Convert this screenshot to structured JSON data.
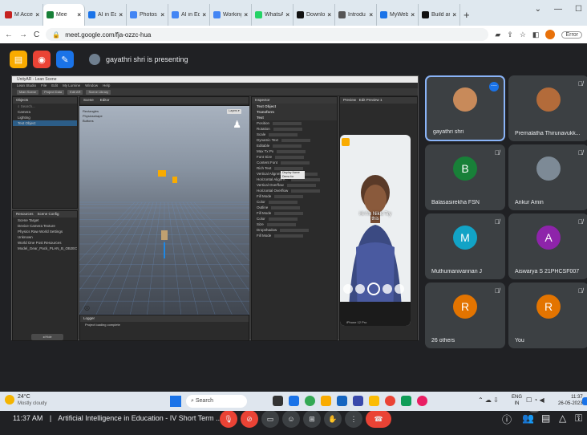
{
  "browser": {
    "tabs": [
      {
        "label": "M Accepte",
        "color": "#c5221f"
      },
      {
        "label": "Mee",
        "color": "#188038",
        "active": true
      },
      {
        "label": "AI in Edu",
        "color": "#1a73e8"
      },
      {
        "label": "Photos",
        "color": "#4285f4"
      },
      {
        "label": "AI in Edu",
        "color": "#4285f4"
      },
      {
        "label": "Working",
        "color": "#4285f4"
      },
      {
        "label": "WhatsA",
        "color": "#25d366"
      },
      {
        "label": "Downlo",
        "color": "#111111"
      },
      {
        "label": "Introdu",
        "color": "#555555"
      },
      {
        "label": "MyWeb",
        "color": "#1a73e8"
      },
      {
        "label": "Build an",
        "color": "#111111"
      }
    ],
    "new_tab": "+",
    "url": "meet.google.com/fja-ozzc-hua",
    "ext_label": "Error"
  },
  "meet": {
    "presenting_text": "gayathri shri is presenting",
    "participants": [
      {
        "name": "gayathri shri",
        "initial": "",
        "color": "#c88a5a",
        "active": true
      },
      {
        "name": "Premalatha Thirunavukk...",
        "initial": "",
        "color": "#b36b3a"
      },
      {
        "name": "Balasasirekha FSN",
        "initial": "B",
        "color": "#188038"
      },
      {
        "name": "Ankur Amin",
        "initial": "",
        "color": "#7d8a96"
      },
      {
        "name": "Muthumanivannan J",
        "initial": "M",
        "color": "#12a3c6"
      },
      {
        "name": "Aiswarya S 21PHCSF007",
        "initial": "A",
        "color": "#8e24aa"
      },
      {
        "name": "26 others",
        "initial": "R",
        "color": "#e37400"
      },
      {
        "name": "You",
        "initial": "R",
        "color": "#e37400"
      }
    ],
    "footer": {
      "time": "11:37 AM",
      "separator": "|",
      "title": "Artificial Intelligence in Education - IV Short Term ...",
      "people_count": "33"
    }
  },
  "unity": {
    "window_title": "UnityAR - Lean Scene",
    "menu": [
      "Lean Studio",
      "File",
      "Edit",
      "My Lumine",
      "Window",
      "Help"
    ],
    "toolbar_labels": [
      "Main Scene",
      "Project Data",
      "Edit AR",
      "Scene Library"
    ],
    "hierarchy_title": "Objects",
    "hierarchy_items": [
      "Camera",
      "Lighting",
      "Text Object"
    ],
    "resources_title": "Resources",
    "resources_tab2": "Scene Config",
    "resources_items": [
      "Scene Target",
      "Device Camera Texture",
      "Physics Raw World Settings",
      "Unknown",
      "World One Post Resources",
      "Model_Gear_Pack_PLAN_B_OBJECTS"
    ],
    "scene_tabs": [
      "Scene",
      "Editor"
    ],
    "scene_layers": [
      "Rectangles",
      "Physicsshape",
      "Buttons"
    ],
    "inspector_title": "Inspector",
    "inspector_sections": [
      "Text Object",
      "Transform",
      "Text"
    ],
    "inspector_rows": [
      "Position",
      "Rotation",
      "Scale",
      "Dynamic Text",
      "Editable",
      "Max Tx Px",
      "Font Size",
      "Content Font",
      "Rich Text",
      "Vertical Alignment",
      "Horizontal Alignm...",
      "Vertical Overflow",
      "Horizontal Overflow",
      "Fill Mode",
      "Color",
      "Outline",
      "Fill Mode",
      "Color",
      "Size",
      "Dropshadow",
      "Fill Mode"
    ],
    "preview_title": "Preview",
    "preview_tab2": "Edit Preview 1",
    "text_field_label": "Display Name",
    "text_field_value": "Demo for Lumine",
    "logger_title": "Logger",
    "logger_line": "Project loading complete",
    "phone_caption": "Hi I'm Nikki Try this",
    "phone_footer": "iPhone 12 Pro"
  },
  "taskbar": {
    "weather_temp": "24°C",
    "weather_desc": "Mostly cloudy",
    "search_label": "Search",
    "lang": "ENG",
    "lang_sub": "IN",
    "time": "11:37",
    "date": "26-05-2023"
  }
}
